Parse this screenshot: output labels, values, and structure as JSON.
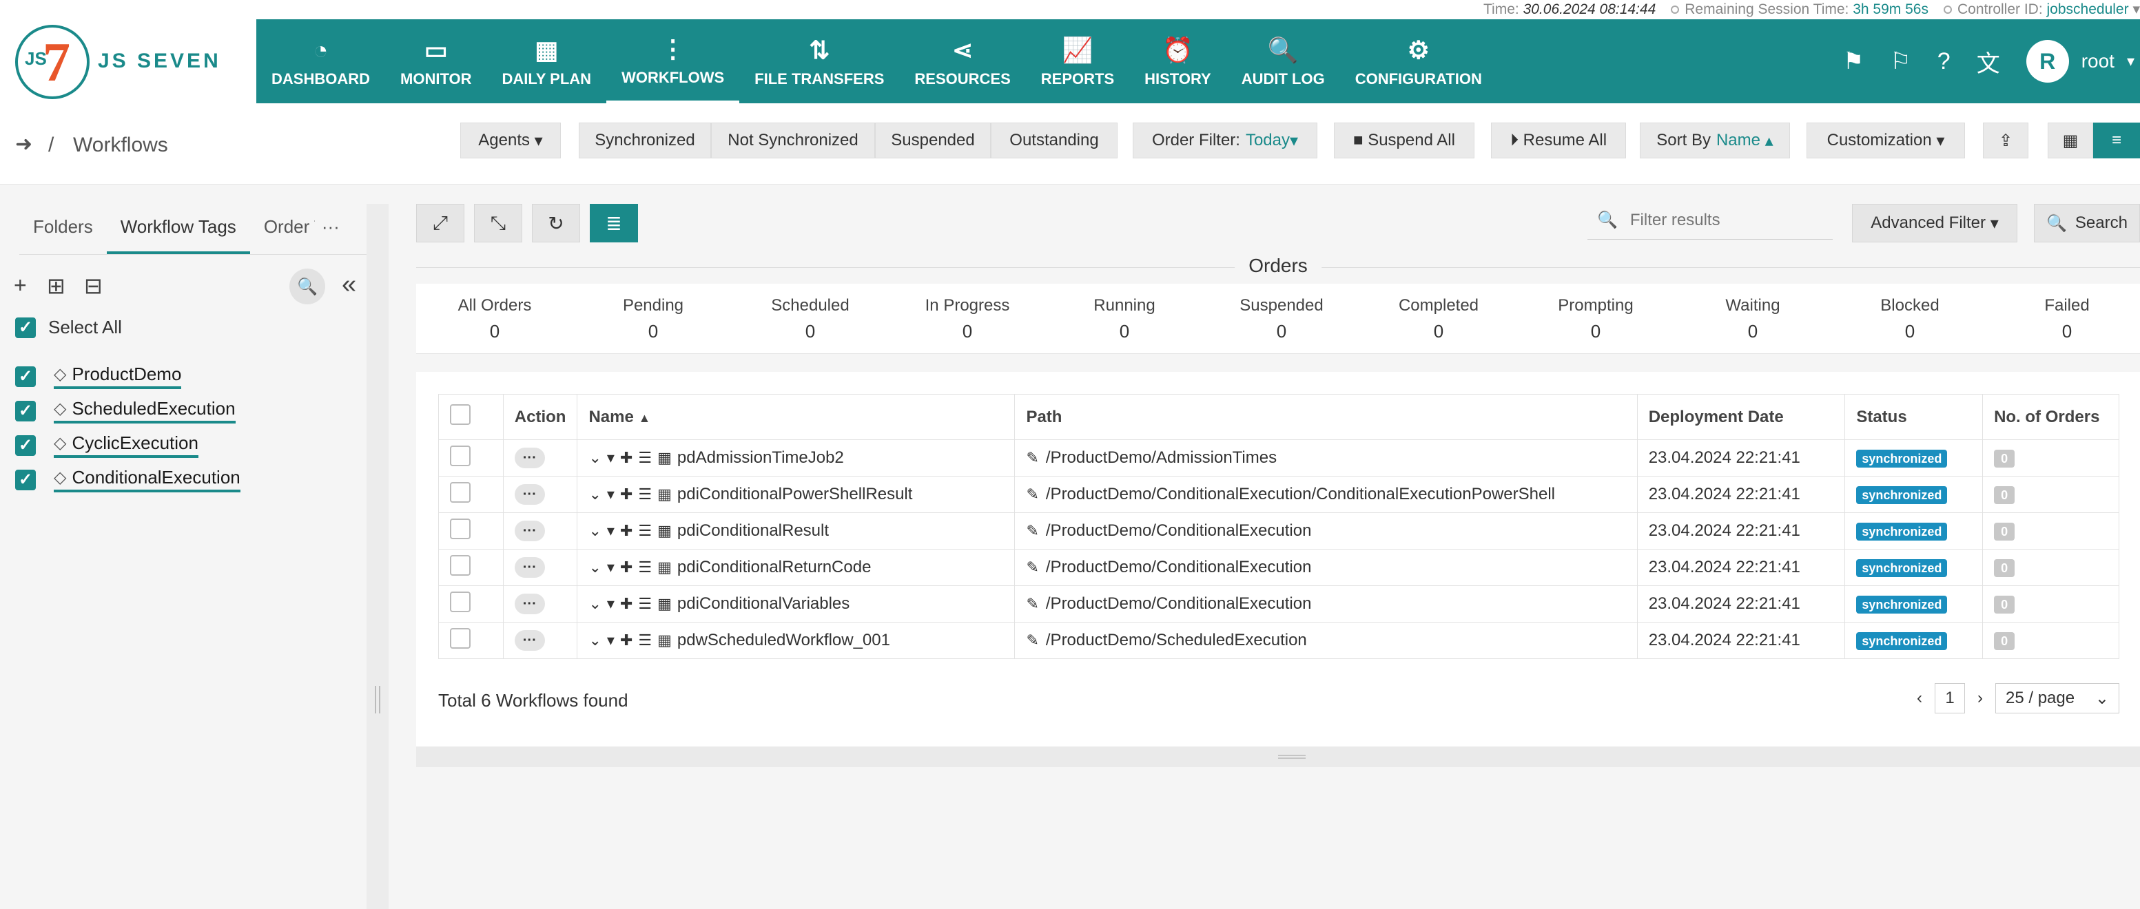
{
  "status_bar": {
    "time_label": "Time:",
    "time_value": "30.06.2024 08:14:44",
    "session_label": "Remaining Session Time:",
    "session_value": "3h 59m 56s",
    "controller_label": "Controller ID:",
    "controller_value": "jobscheduler"
  },
  "brand": {
    "logo_js": "JS",
    "logo_seven": "7",
    "name": "JS SEVEN",
    "primary_color": "#1a8a8a",
    "accent_color": "#e8562a"
  },
  "nav": [
    {
      "label": "DASHBOARD",
      "icon": "dashboard-icon"
    },
    {
      "label": "MONITOR",
      "icon": "monitor-icon"
    },
    {
      "label": "DAILY PLAN",
      "icon": "calendar-icon"
    },
    {
      "label": "WORKFLOWS",
      "icon": "workflow-icon"
    },
    {
      "label": "FILE TRANSFERS",
      "icon": "transfer-icon"
    },
    {
      "label": "RESOURCES",
      "icon": "share-icon"
    },
    {
      "label": "REPORTS",
      "icon": "chart-icon"
    },
    {
      "label": "HISTORY",
      "icon": "alarm-icon"
    },
    {
      "label": "AUDIT LOG",
      "icon": "audit-icon"
    },
    {
      "label": "CONFIGURATION",
      "icon": "gear-icon"
    }
  ],
  "user": {
    "avatar": "R",
    "name": "root"
  },
  "breadcrumb": {
    "sep": "/",
    "title": "Workflows"
  },
  "toolbar": {
    "agents": "Agents",
    "synchronized": "Synchronized",
    "not_synchronized": "Not Synchronized",
    "suspended": "Suspended",
    "outstanding": "Outstanding",
    "order_filter_label": "Order Filter:",
    "order_filter_value": "Today",
    "suspend_all": "Suspend All",
    "resume_all": "Resume All",
    "sort_by_label": "Sort By",
    "sort_by_value": "Name",
    "customization": "Customization"
  },
  "sidebar": {
    "tabs": [
      "Folders",
      "Workflow Tags",
      "Order Tags"
    ],
    "more": "···",
    "select_all": "Select All",
    "tags": [
      "ProductDemo",
      "ScheduledExecution",
      "CyclicExecution",
      "ConditionalExecution"
    ]
  },
  "search": {
    "placeholder": "Filter results",
    "advanced": "Advanced Filter",
    "search_label": "Search"
  },
  "orders": {
    "title": "Orders",
    "states": [
      {
        "label": "All Orders",
        "count": "0"
      },
      {
        "label": "Pending",
        "count": "0"
      },
      {
        "label": "Scheduled",
        "count": "0"
      },
      {
        "label": "In Progress",
        "count": "0"
      },
      {
        "label": "Running",
        "count": "0"
      },
      {
        "label": "Suspended",
        "count": "0"
      },
      {
        "label": "Completed",
        "count": "0"
      },
      {
        "label": "Prompting",
        "count": "0"
      },
      {
        "label": "Waiting",
        "count": "0"
      },
      {
        "label": "Blocked",
        "count": "0"
      },
      {
        "label": "Failed",
        "count": "0"
      }
    ]
  },
  "table": {
    "headers": [
      "Action",
      "Name",
      "Path",
      "Deployment Date",
      "Status",
      "No. of Orders"
    ],
    "rows": [
      {
        "name": "pdAdmissionTimeJob2",
        "path": "/ProductDemo/AdmissionTimes",
        "date": "23.04.2024 22:21:41",
        "status": "synchronized",
        "orders": "0"
      },
      {
        "name": "pdiConditionalPowerShellResult",
        "path": "/ProductDemo/ConditionalExecution/ConditionalExecutionPowerShell",
        "date": "23.04.2024 22:21:41",
        "status": "synchronized",
        "orders": "0"
      },
      {
        "name": "pdiConditionalResult",
        "path": "/ProductDemo/ConditionalExecution",
        "date": "23.04.2024 22:21:41",
        "status": "synchronized",
        "orders": "0"
      },
      {
        "name": "pdiConditionalReturnCode",
        "path": "/ProductDemo/ConditionalExecution",
        "date": "23.04.2024 22:21:41",
        "status": "synchronized",
        "orders": "0"
      },
      {
        "name": "pdiConditionalVariables",
        "path": "/ProductDemo/ConditionalExecution",
        "date": "23.04.2024 22:21:41",
        "status": "synchronized",
        "orders": "0"
      },
      {
        "name": "pdwScheduledWorkflow_001",
        "path": "/ProductDemo/ScheduledExecution",
        "date": "23.04.2024 22:21:41",
        "status": "synchronized",
        "orders": "0"
      }
    ],
    "status_color": "#1a8fbf"
  },
  "footer": {
    "total": "Total 6 Workflows found",
    "page": "1",
    "page_size": "25 / page"
  }
}
